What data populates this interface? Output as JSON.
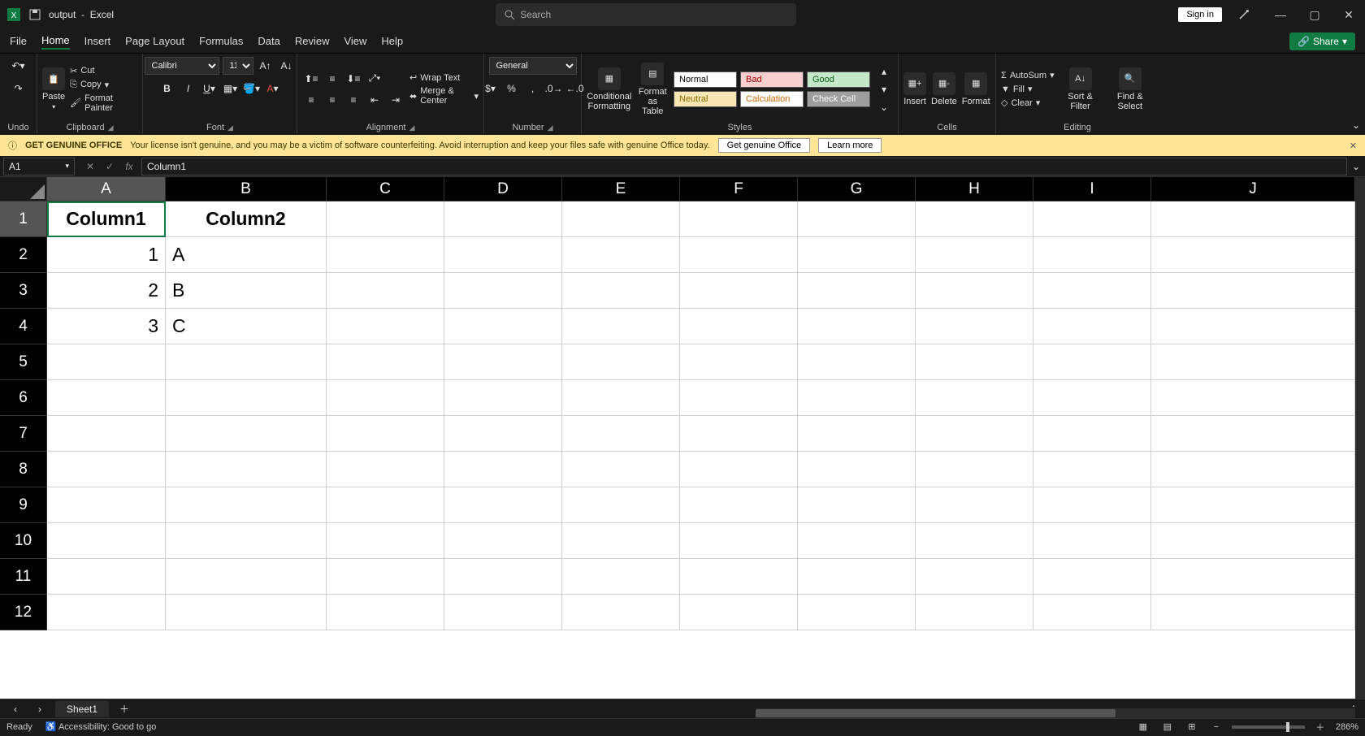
{
  "title": {
    "filename": "output",
    "app": "Excel"
  },
  "search_placeholder": "Search",
  "signin": "Sign in",
  "tabs": [
    "File",
    "Home",
    "Insert",
    "Page Layout",
    "Formulas",
    "Data",
    "Review",
    "View",
    "Help"
  ],
  "active_tab": "Home",
  "share": "Share",
  "ribbon": {
    "undo_label": "Undo",
    "paste": "Paste",
    "cut": "Cut",
    "copy": "Copy",
    "format_painter": "Format Painter",
    "clipboard_label": "Clipboard",
    "font_name": "Calibri",
    "font_size": "11",
    "font_label": "Font",
    "wrap": "Wrap Text",
    "merge": "Merge & Center",
    "alignment_label": "Alignment",
    "num_format": "General",
    "number_label": "Number",
    "cond": "Conditional Formatting",
    "fmt_table": "Format as Table",
    "styles": {
      "normal": "Normal",
      "bad": "Bad",
      "good": "Good",
      "neutral": "Neutral",
      "calc": "Calculation",
      "check": "Check Cell"
    },
    "styles_label": "Styles",
    "insert": "Insert",
    "delete": "Delete",
    "format": "Format",
    "cells_label": "Cells",
    "autosum": "AutoSum",
    "fill": "Fill",
    "clear": "Clear",
    "sort": "Sort & Filter",
    "find": "Find & Select",
    "editing_label": "Editing"
  },
  "warning": {
    "title": "GET GENUINE OFFICE",
    "text": "Your license isn't genuine, and you may be a victim of software counterfeiting. Avoid interruption and keep your files safe with genuine Office today.",
    "btn1": "Get genuine Office",
    "btn2": "Learn more"
  },
  "name_box": "A1",
  "formula_value": "Column1",
  "columns": [
    "A",
    "B",
    "C",
    "D",
    "E",
    "F",
    "G",
    "H",
    "I",
    "J"
  ],
  "row_count": 12,
  "table": {
    "headers": [
      "Column1",
      "Column2"
    ],
    "rows": [
      {
        "a": "1",
        "b": "A"
      },
      {
        "a": "2",
        "b": "B"
      },
      {
        "a": "3",
        "b": "C"
      }
    ]
  },
  "sheet_name": "Sheet1",
  "status": {
    "ready": "Ready",
    "acc": "Accessibility: Good to go",
    "zoom": "286%"
  }
}
